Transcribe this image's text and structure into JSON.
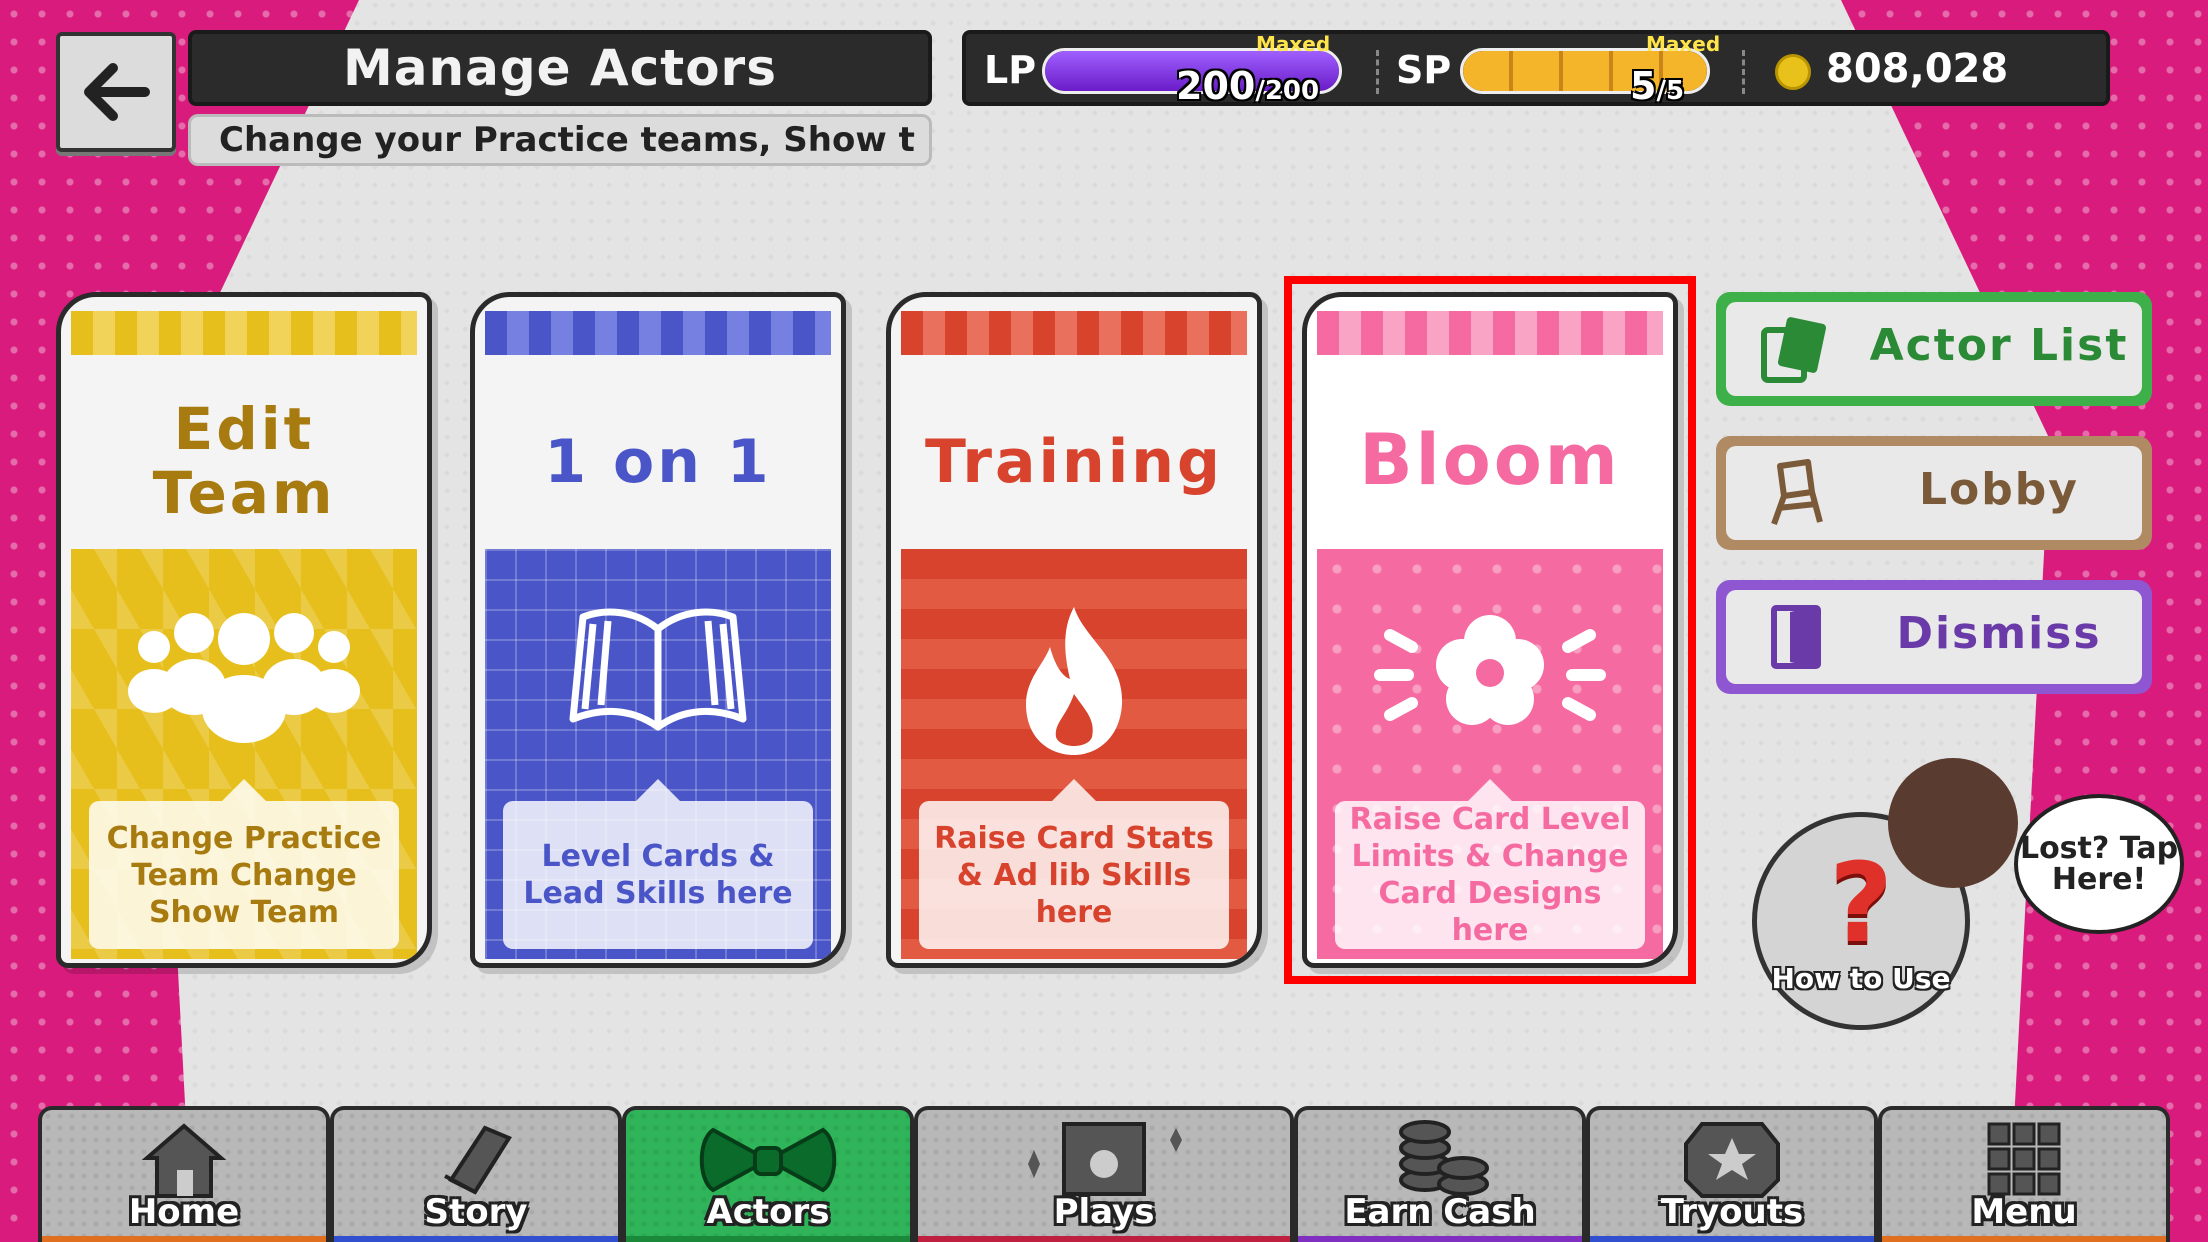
{
  "header": {
    "title": "Manage Actors",
    "subtitle": "Change your Practice teams, Show t",
    "back_icon": "arrow-left-icon"
  },
  "status": {
    "lp_label": "LP",
    "lp_maxed": "Maxed",
    "lp_value": "200",
    "lp_max": "/200",
    "lp_fraction": 1.0,
    "sp_label": "SP",
    "sp_maxed": "Maxed",
    "sp_value": "5",
    "sp_max": "/5",
    "sp_fraction": 1.0,
    "money": "808,028"
  },
  "cards": [
    {
      "title": "Edit\nTeam",
      "desc": "Change Practice Team Change Show Team",
      "icon": "team-icon",
      "color": "#e7bf1c"
    },
    {
      "title": "1 on 1",
      "desc": "Level Cards & Lead Skills here",
      "icon": "book-icon",
      "color": "#4a56c8"
    },
    {
      "title": "Training",
      "desc": "Raise Card Stats & Ad lib Skills here",
      "icon": "flame-icon",
      "color": "#d8432d"
    },
    {
      "title": "Bloom",
      "desc": "Raise Card Level Limits & Change Card Designs here",
      "icon": "flower-icon",
      "color": "#f56aa0"
    }
  ],
  "side": {
    "actor_list": "Actor List",
    "lobby": "Lobby",
    "dismiss": "Dismiss"
  },
  "help": {
    "how_to_use": "How to Use",
    "bubble": "Lost? Tap Here!",
    "question_mark": "?"
  },
  "nav": [
    {
      "label": "Home",
      "icon": "home-icon"
    },
    {
      "label": "Story",
      "icon": "story-book-icon"
    },
    {
      "label": "Actors",
      "icon": "bowtie-icon"
    },
    {
      "label": "Plays",
      "icon": "theater-icon"
    },
    {
      "label": "Earn Cash",
      "icon": "coins-icon"
    },
    {
      "label": "Tryouts",
      "icon": "star-badge-icon"
    },
    {
      "label": "Menu",
      "icon": "grid-icon"
    }
  ],
  "colors": {
    "background_pink": "#d81b7c",
    "highlight": "#ff0000",
    "active_nav": "#2fb45a",
    "lp_gauge": "#7c2cd8",
    "sp_gauge": "#f0a21c"
  }
}
